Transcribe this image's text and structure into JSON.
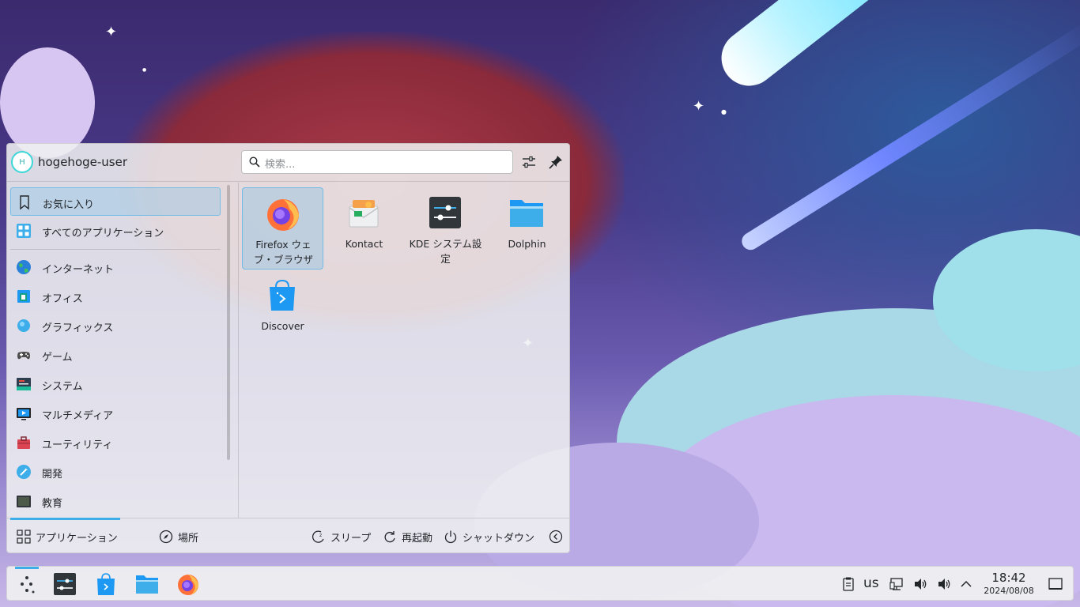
{
  "launcher": {
    "user": {
      "initial": "H",
      "name": "hogehoge-user"
    },
    "search": {
      "placeholder": "検索..."
    },
    "sidebar": {
      "items": [
        {
          "label": "お気に入り",
          "icon": "bookmark-icon",
          "selected": true
        },
        {
          "label": "すべてのアプリケーション",
          "icon": "grid-icon"
        },
        {
          "label": "インターネット",
          "icon": "globe-icon"
        },
        {
          "label": "オフィス",
          "icon": "office-icon"
        },
        {
          "label": "グラフィックス",
          "icon": "graphics-icon"
        },
        {
          "label": "ゲーム",
          "icon": "gamepad-icon"
        },
        {
          "label": "システム",
          "icon": "system-icon"
        },
        {
          "label": "マルチメディア",
          "icon": "multimedia-icon"
        },
        {
          "label": "ユーティリティ",
          "icon": "toolbox-icon"
        },
        {
          "label": "開発",
          "icon": "development-icon"
        },
        {
          "label": "教育",
          "icon": "chalkboard-icon"
        }
      ]
    },
    "favorites": [
      {
        "name": "Firefox ウェブ・ブラウザ",
        "icon": "firefox-icon",
        "selected": true
      },
      {
        "name": "Kontact",
        "icon": "kontact-icon"
      },
      {
        "name": "KDE システム設定",
        "icon": "system-settings-icon"
      },
      {
        "name": "Dolphin",
        "icon": "dolphin-folder-icon"
      },
      {
        "name": "Discover",
        "icon": "discover-icon"
      }
    ],
    "footer": {
      "applications": "アプリケーション",
      "places": "場所",
      "sleep": "スリープ",
      "restart": "再起動",
      "shutdown": "シャットダウン"
    }
  },
  "taskbar": {
    "keyboard_layout": "us",
    "clock": {
      "time": "18:42",
      "date": "2024/08/08"
    }
  },
  "colors": {
    "accent": "#3daee9",
    "panel": "#eff0f1"
  }
}
